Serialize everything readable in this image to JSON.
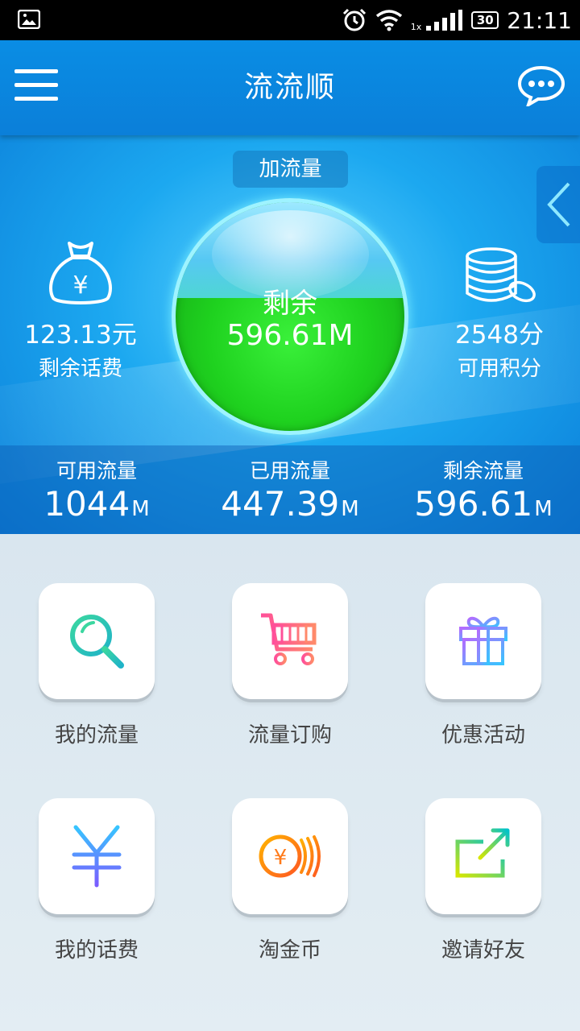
{
  "status_bar": {
    "time": "21:11",
    "battery": "30",
    "signal_label": "1x"
  },
  "app_bar": {
    "title": "流流顺"
  },
  "hero": {
    "add_button": "加流量",
    "orb": {
      "label": "剩余",
      "value": "596.61M",
      "fill_fraction": 0.58
    },
    "left": {
      "value": "123.13元",
      "label": "剩余话费"
    },
    "right": {
      "value": "2548分",
      "label": "可用积分"
    },
    "stats": [
      {
        "label": "可用流量",
        "value": "1044",
        "unit": "M"
      },
      {
        "label": "已用流量",
        "value": "447.39",
        "unit": "M"
      },
      {
        "label": "剩余流量",
        "value": "596.61",
        "unit": "M"
      }
    ]
  },
  "grid": {
    "items": [
      {
        "label": "我的流量",
        "icon": "magnifier-icon"
      },
      {
        "label": "流量订购",
        "icon": "shopping-cart-icon"
      },
      {
        "label": "优惠活动",
        "icon": "gift-icon"
      },
      {
        "label": "我的话费",
        "icon": "yuan-icon"
      },
      {
        "label": "淘金币",
        "icon": "coin-icon"
      },
      {
        "label": "邀请好友",
        "icon": "share-icon"
      }
    ]
  }
}
